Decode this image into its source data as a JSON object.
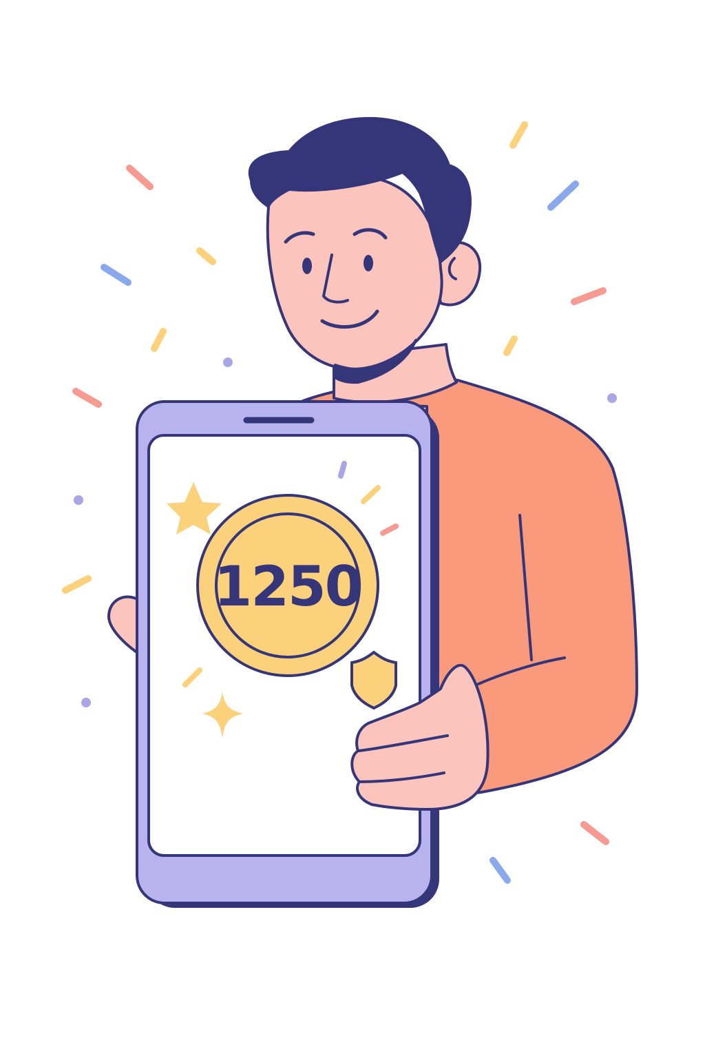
{
  "coin": {
    "value": "1250"
  },
  "colors": {
    "outline": "#35357a",
    "hair": "#35357a",
    "skin": "#fbc4bd",
    "shirt": "#fa9a7d",
    "phone_body": "#b8b2ee",
    "screen": "#ffffff",
    "coin": "#fbd27b",
    "star": "#fbd27b",
    "confetti_pink": "#f69a92",
    "confetti_blue": "#8aa8ec",
    "confetti_yellow": "#fbd27b",
    "confetti_purple": "#a9a6e6"
  },
  "icons": {
    "star": "star-icon",
    "sparkle": "sparkle-icon",
    "shield": "shield-icon",
    "coin": "coin-icon"
  }
}
